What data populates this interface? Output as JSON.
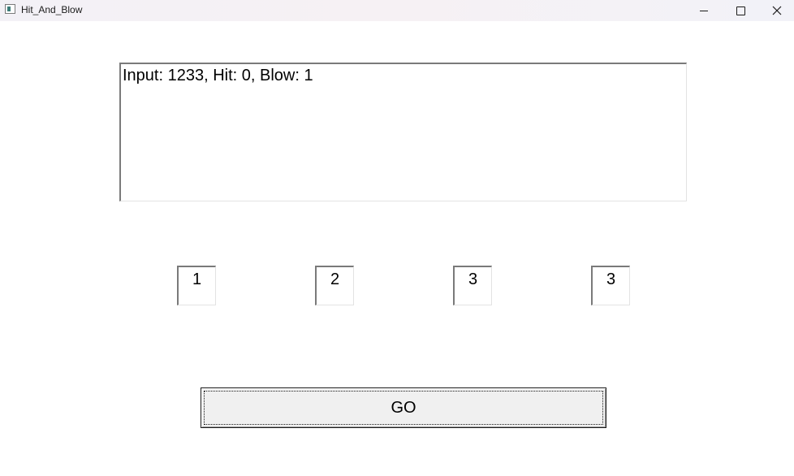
{
  "window": {
    "title": "Hit_And_Blow",
    "app_icon": "window-app-icon",
    "controls": [
      "minimize-icon",
      "maximize-icon",
      "close-icon"
    ],
    "close_glyph": "✕"
  },
  "output": {
    "text": "Input: 1233, Hit: 0, Blow: 1"
  },
  "digits": [
    "1",
    "2",
    "3",
    "3"
  ],
  "go_button": {
    "label": "GO"
  }
}
